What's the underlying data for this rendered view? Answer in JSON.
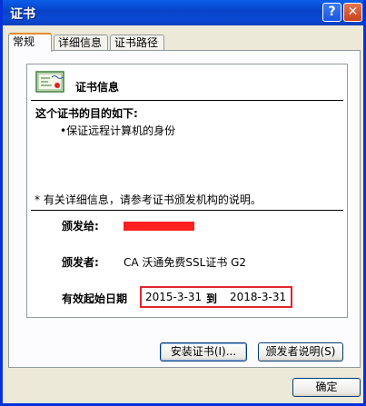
{
  "window": {
    "title": "证书",
    "help_label": "?",
    "close_label": "✕"
  },
  "tabs": [
    {
      "label": "常规",
      "active": true
    },
    {
      "label": "详细信息",
      "active": false
    },
    {
      "label": "证书路径",
      "active": false
    }
  ],
  "cert": {
    "header": "证书信息",
    "purpose_heading": "这个证书的目的如下:",
    "purposes": [
      "•保证远程计算机的身份"
    ],
    "note": "* 有关详细信息，请参考证书颁发机构的说明。",
    "issued_to_label": "颁发给:",
    "issued_by_label": "颁发者:",
    "issued_by_value": "CA 沃通免费SSL证书 G2",
    "validity_label": "有效起始日期",
    "valid_from": "2015-3-31",
    "to_word": "到",
    "valid_to": "2018-3-31"
  },
  "buttons": {
    "install": "安装证书(I)...",
    "issuer_statement": "颁发者说明(S)",
    "ok": "确定"
  },
  "colors": {
    "titlebar": "#0842c8",
    "highlight": "#e3242b",
    "redaction": "#ff2020"
  }
}
